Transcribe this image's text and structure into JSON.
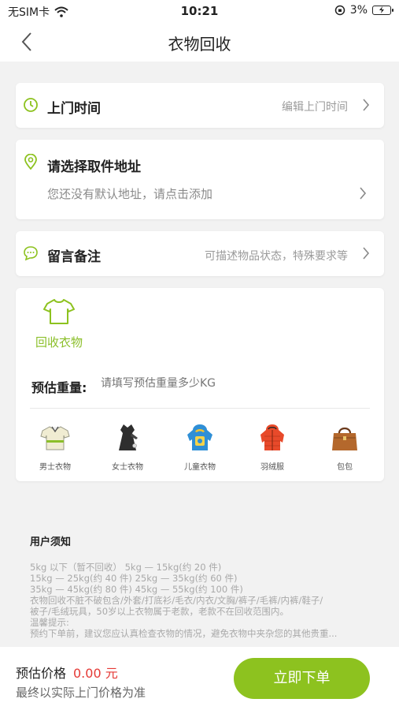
{
  "status_bar": {
    "carrier": "无SIM卡",
    "time": "10:21",
    "battery": "3%"
  },
  "nav": {
    "title": "衣物回收"
  },
  "pickup_time": {
    "label": "上门时间",
    "hint": "编辑上门时间"
  },
  "address": {
    "label": "请选择取件地址",
    "hint": "您还没有默认地址，请点击添加"
  },
  "remark": {
    "label": "留言备注",
    "hint": "可描述物品状态，特殊要求等"
  },
  "recycle": {
    "title": "回收衣物",
    "weight_label": "预估重量:",
    "weight_placeholder": "请填写预估重量多少KG",
    "categories": [
      {
        "label": "男士衣物",
        "icon": "mens-shirt-icon"
      },
      {
        "label": "女士衣物",
        "icon": "womens-dress-icon"
      },
      {
        "label": "儿童衣物",
        "icon": "kids-jacket-icon"
      },
      {
        "label": "羽绒服",
        "icon": "down-jacket-icon"
      },
      {
        "label": "包包",
        "icon": "handbag-icon"
      }
    ]
  },
  "notice": {
    "title": "用户须知",
    "lines": [
      "5kg 以下（暂不回收）   5kg — 15kg(约 20 件)",
      "15kg — 25kg(约 40 件)    25kg — 35kg(约 60 件)",
      "35kg — 45kg(约 80 件)    45kg — 55kg(约 100 件)",
      "衣物回收不脏不破包含/外套/打底衫/毛衣/内衣/文胸/裤子/毛裤/内裤/鞋子/",
      "被子/毛绒玩具，50岁以上衣物属于老款，老款不在回收范围内。",
      "温馨提示:",
      "预约下单前，建议您应认真检查衣物的情况，避免衣物中夹杂您的其他贵重..."
    ]
  },
  "bottom_bar": {
    "price_label": "预估价格",
    "price_value": "0.00 元",
    "price_note": "最终以实际上门价格为准",
    "order_button": "立即下单"
  },
  "colors": {
    "accent": "#8dc21f",
    "price": "#e53935"
  }
}
